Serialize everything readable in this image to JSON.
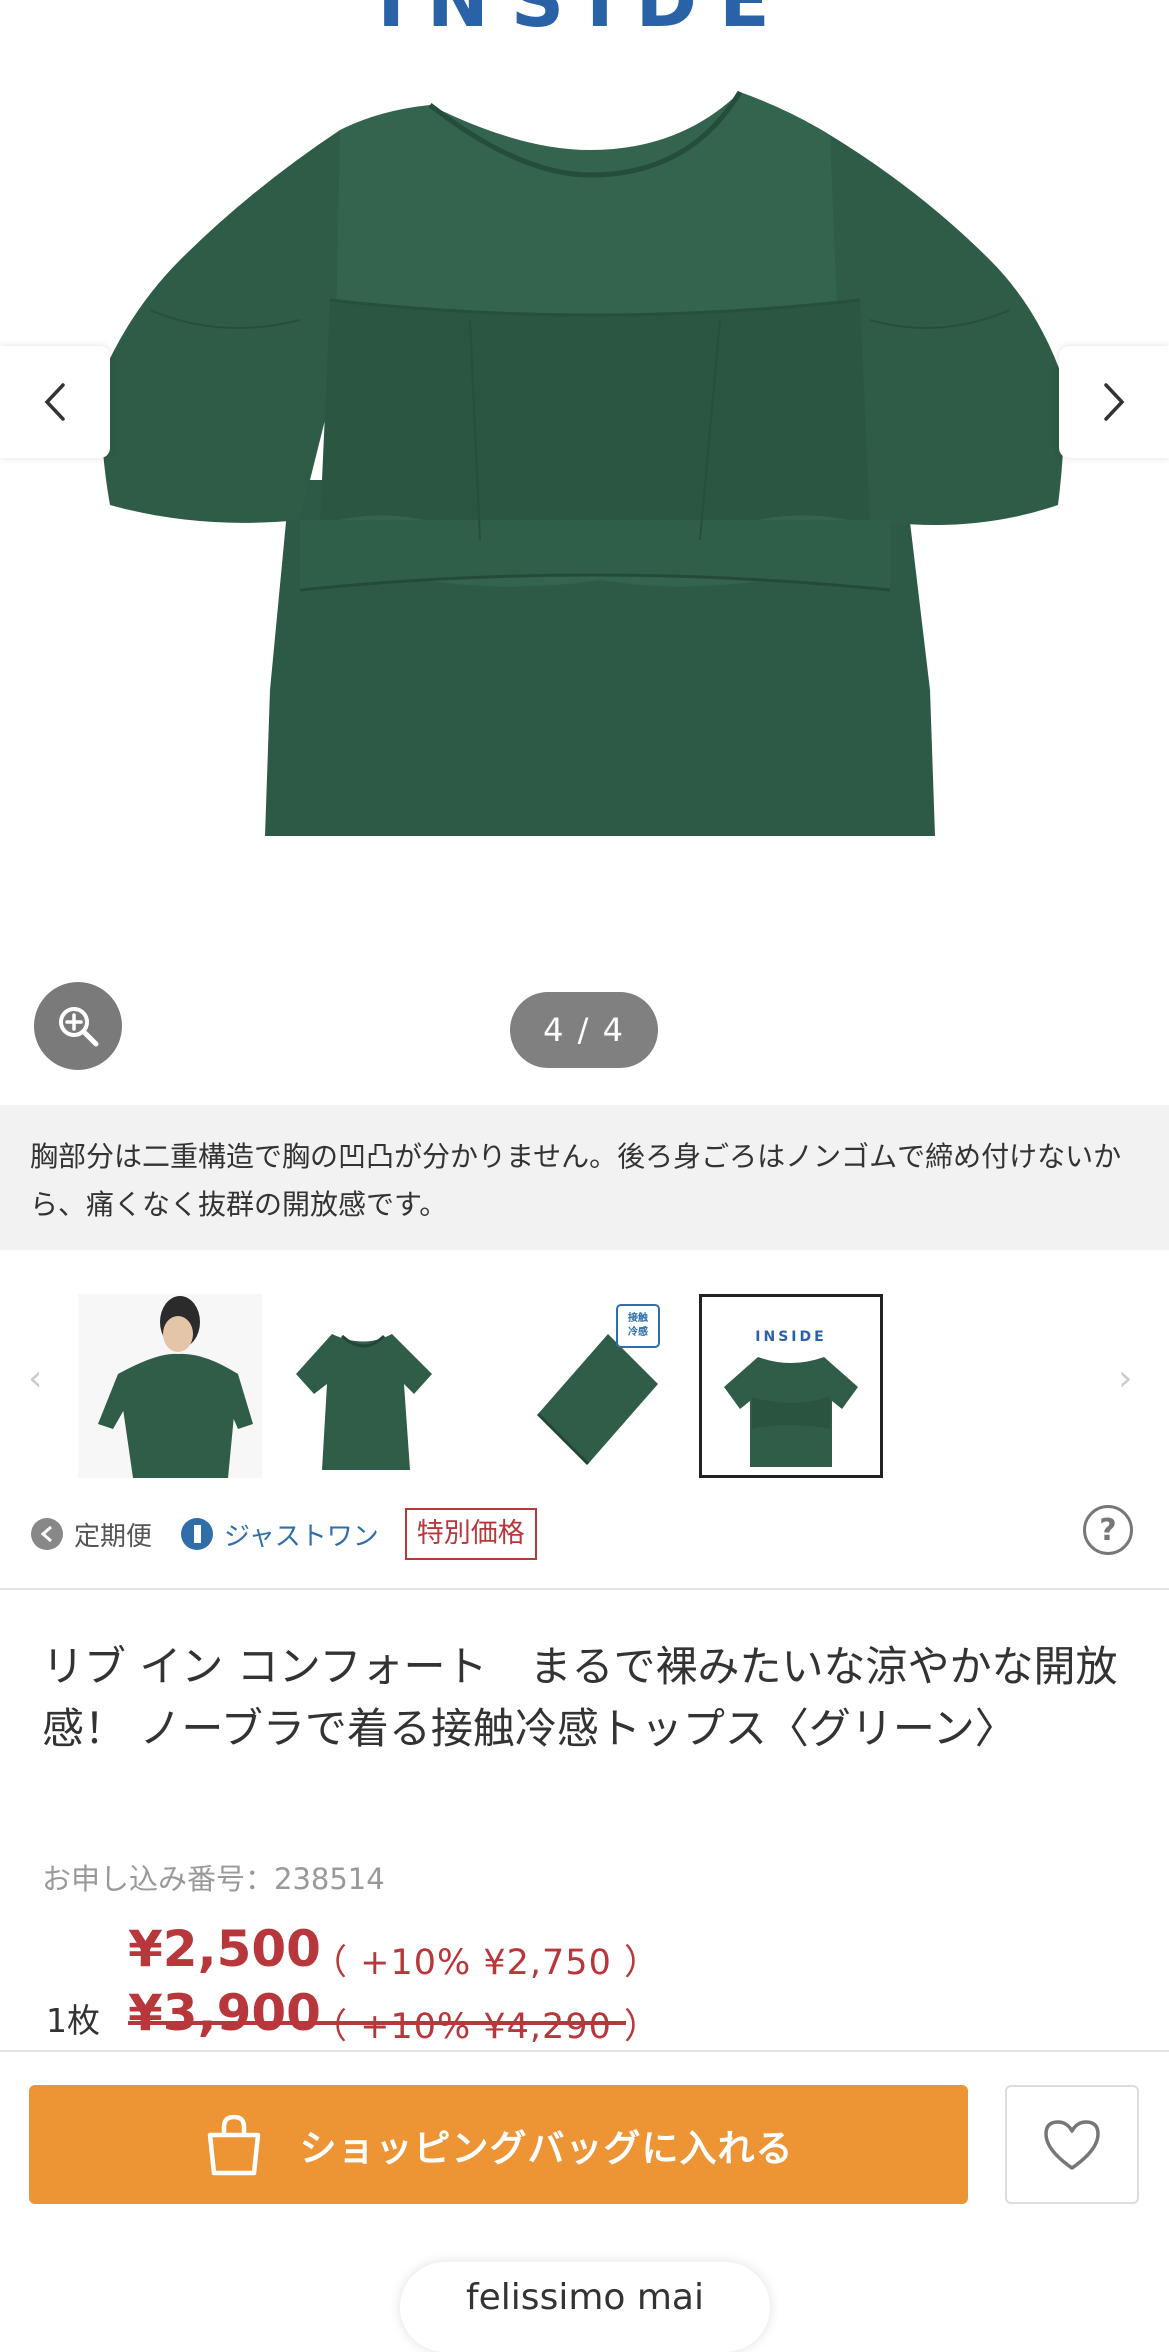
{
  "gallery": {
    "inside_label": "INSIDE",
    "counter": "4 / 4",
    "caption": "胸部分は二重構造で胸の凹凸が分かりません。後ろ身ごろはノンゴムで締め付けないから、痛くなく抜群の開放感です。",
    "thumbnails": [
      {
        "name": "model"
      },
      {
        "name": "flat"
      },
      {
        "name": "fabric",
        "tag_line1": "接触",
        "tag_line2": "冷感"
      },
      {
        "name": "inside",
        "label": "INSIDE",
        "selected": true
      }
    ],
    "garment_color": "#2f5d48"
  },
  "badges": {
    "teiki": "定期便",
    "just_one": "ジャストワン",
    "special_price": "特別価格"
  },
  "product": {
    "title": "リブ イン コンフォート　まるで裸みたいな涼やかな開放感！ ノーブラで着る接触冷感トップス〈グリーン〉",
    "order_number": "お申し込み番号：238514",
    "price": "¥2,500",
    "price_with_tax": "（ +10%  ¥2,750 ）",
    "quantity_label": "1枚",
    "original_price": "¥3,900",
    "original_price_with_tax": "（ +10%  ¥4,290 ）"
  },
  "actions": {
    "add_to_bag": "ショッピングバッグに入れる"
  },
  "peek_text": "felissimo mai",
  "colors": {
    "accent_orange": "#ed9434",
    "price_red": "#b7373b",
    "link_blue": "#2f6ea8"
  }
}
